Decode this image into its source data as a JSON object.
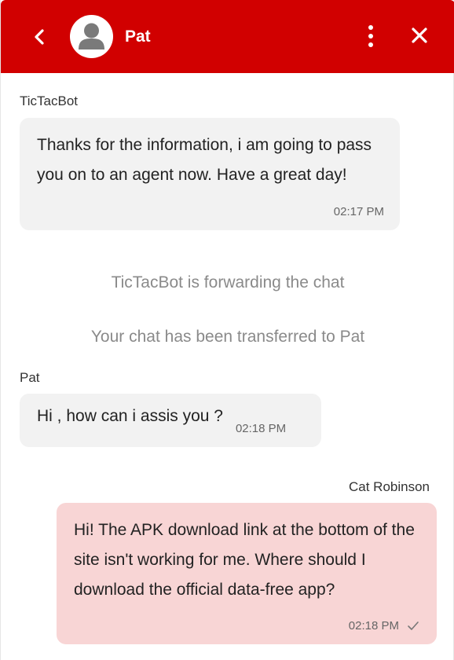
{
  "header": {
    "contact_name": "Pat"
  },
  "messages": {
    "bot": {
      "sender": "TicTacBot",
      "text": "Thanks for the information, i am going to pass you on to an agent now. Have a great day!",
      "time": "02:17 PM"
    },
    "system_forward": "TicTacBot is forwarding the chat",
    "system_transfer": "Your chat has been transferred to Pat",
    "agent": {
      "sender": "Pat",
      "text": "Hi , how can i assis you ?",
      "time": "02:18 PM"
    },
    "user": {
      "sender": "Cat Robinson",
      "text": "Hi! The APK download link at the bottom of the site isn't working for me. Where should I download the official data-free app?",
      "time": "02:18 PM",
      "status_icon": "check-icon"
    }
  },
  "colors": {
    "header_bg": "#d10000",
    "incoming_bubble": "#f2f2f2",
    "outgoing_bubble": "#f8d5d5"
  }
}
